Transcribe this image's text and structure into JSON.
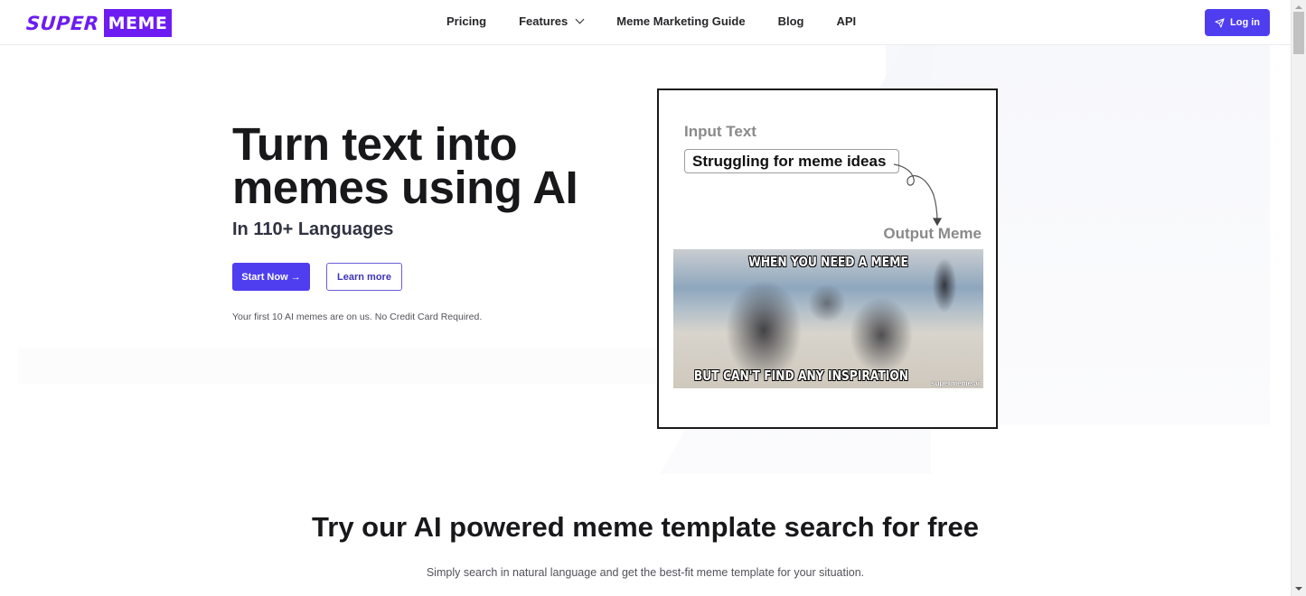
{
  "brand": {
    "logo_part1": "SUPER",
    "logo_part2": "MEME",
    "accent_color": "#6d1cf2",
    "button_color": "#4f3ef0"
  },
  "nav": {
    "items": [
      {
        "label": "Pricing"
      },
      {
        "label": "Features",
        "has_dropdown": true
      },
      {
        "label": "Meme Marketing Guide"
      },
      {
        "label": "Blog"
      },
      {
        "label": "API"
      }
    ],
    "login_label": "Log in",
    "login_icon": "send-icon"
  },
  "hero": {
    "title": "Turn text into memes using AI",
    "subtitle": "In 110+ Languages",
    "start_button": "Start Now →",
    "learn_button": "Learn more",
    "note": "Your first 10 AI memes are on us. No Credit Card Required."
  },
  "demo": {
    "input_label": "Input Text",
    "input_value": "Struggling for meme ideas",
    "output_label": "Output Meme",
    "meme_top_text": "WHEN YOU NEED A MEME",
    "meme_bottom_text": "BUT CAN'T FIND ANY INSPIRATION",
    "meme_watermark": "supermeme.ai"
  },
  "search_section": {
    "title": "Try our AI powered meme template search for free",
    "description": "Simply search in natural language and get the best-fit meme template for your situation."
  }
}
